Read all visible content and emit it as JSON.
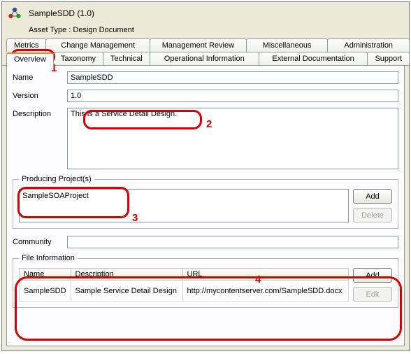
{
  "header": {
    "title": "SampleSDD (1.0)",
    "asset_type_label": "Asset Type : Design Document"
  },
  "tabs_upper": [
    {
      "label": "Metrics"
    },
    {
      "label": "Change Management"
    },
    {
      "label": "Management Review"
    },
    {
      "label": "Miscellaneous"
    },
    {
      "label": "Administration"
    }
  ],
  "tabs_lower": [
    {
      "label": "Overview",
      "active": true
    },
    {
      "label": "Taxonomy"
    },
    {
      "label": "Technical"
    },
    {
      "label": "Operational Information"
    },
    {
      "label": "External Documentation"
    },
    {
      "label": "Support"
    }
  ],
  "overview": {
    "name_label": "Name",
    "name_value": "SampleSDD",
    "version_label": "Version",
    "version_value": "1.0",
    "description_label": "Description",
    "description_value": "This is a Service Detail Design.",
    "community_label": "Community",
    "community_value": ""
  },
  "producing_projects": {
    "legend": "Producing Project(s)",
    "items": [
      "SampleSOAProject"
    ],
    "add_label": "Add",
    "delete_label": "Delete"
  },
  "file_info": {
    "legend": "File Information",
    "columns": {
      "name": "Name",
      "description": "Description",
      "url": "URL"
    },
    "rows": [
      {
        "name": "SampleSDD",
        "description": "Sample Service Detail Design",
        "url": "http://mycontentserver.com/SampleSDD.docx"
      }
    ],
    "add_label": "Add",
    "edit_label": "Edit"
  },
  "annotations": {
    "n1": "1",
    "n2": "2",
    "n3": "3",
    "n4": "4"
  }
}
